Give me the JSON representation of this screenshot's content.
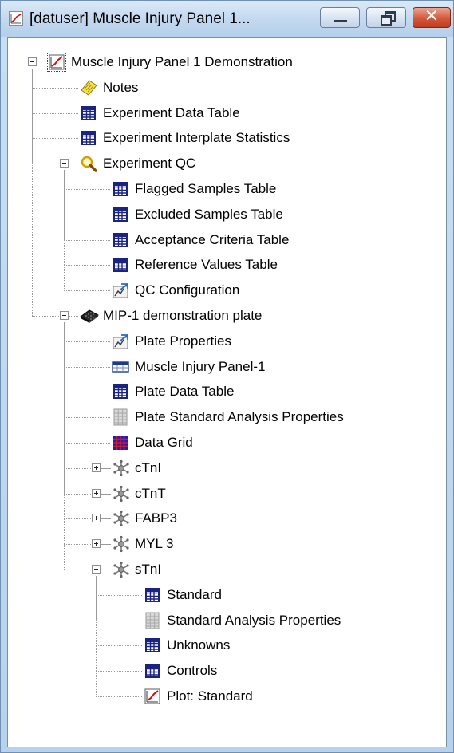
{
  "window": {
    "title": "[datuser] Muscle Injury Panel 1...",
    "controls": {
      "minimize": "minimize",
      "maximize": "restore",
      "close": "✕"
    }
  },
  "tree": {
    "root": {
      "label": "Muscle Injury Panel 1 Demonstration",
      "icon": "plot-icon",
      "expanded": true
    },
    "items": [
      {
        "label": "Notes",
        "icon": "notes-icon"
      },
      {
        "label": "Experiment Data Table",
        "icon": "table-icon"
      },
      {
        "label": "Experiment Interplate Statistics",
        "icon": "table-icon"
      },
      {
        "label": "Experiment QC",
        "icon": "magnifier-icon",
        "expanded": true
      },
      {
        "label": "Flagged Samples Table",
        "icon": "table-icon"
      },
      {
        "label": "Excluded Samples Table",
        "icon": "table-icon"
      },
      {
        "label": "Acceptance Criteria Table",
        "icon": "table-icon"
      },
      {
        "label": "Reference Values Table",
        "icon": "table-icon"
      },
      {
        "label": "QC Configuration",
        "icon": "properties-icon"
      },
      {
        "label": "MIP-1 demonstration plate",
        "icon": "plate-icon",
        "expanded": true
      },
      {
        "label": "Plate Properties",
        "icon": "properties-icon"
      },
      {
        "label": "Muscle Injury Panel-1",
        "icon": "panel-icon"
      },
      {
        "label": "Plate Data Table",
        "icon": "table-icon"
      },
      {
        "label": "Plate Standard Analysis Properties",
        "icon": "gray-table-icon"
      },
      {
        "label": "Data Grid",
        "icon": "data-grid-icon"
      },
      {
        "label": "cTnI",
        "icon": "analyte-icon",
        "expanded": false
      },
      {
        "label": "cTnT",
        "icon": "analyte-icon",
        "expanded": false
      },
      {
        "label": "FABP3",
        "icon": "analyte-icon",
        "expanded": false
      },
      {
        "label": "MYL 3",
        "icon": "analyte-icon",
        "expanded": false
      },
      {
        "label": "sTnI",
        "icon": "analyte-icon",
        "expanded": true
      },
      {
        "label": "Standard",
        "icon": "table-icon"
      },
      {
        "label": "Standard Analysis Properties",
        "icon": "gray-table-icon"
      },
      {
        "label": "Unknowns",
        "icon": "table-icon"
      },
      {
        "label": "Controls",
        "icon": "table-icon"
      },
      {
        "label": "Plot: Standard",
        "icon": "plot-icon"
      }
    ]
  },
  "colors": {
    "titlebar": "#c3d9ef",
    "close_button": "#d2573b",
    "table_icon": "#1a237e",
    "data_grid_blue": "#1b1bd0",
    "data_grid_red": "#d01b1b",
    "plot_red": "#cc1111"
  }
}
